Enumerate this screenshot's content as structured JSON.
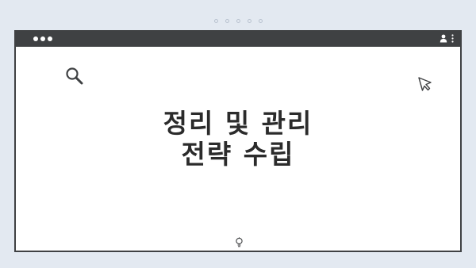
{
  "slide": {
    "title_line1": "정리 및 관리",
    "title_line2": "전략 수립"
  },
  "pager": {
    "dots": 5
  },
  "icons": {
    "search": "search-icon",
    "cursor": "cursor-arrow-icon",
    "bulb": "lightbulb-icon",
    "user": "user-icon",
    "menu": "kebab-menu-icon"
  },
  "colors": {
    "background": "#e3e9f1",
    "titlebar": "#3f4143",
    "window": "#ffffff",
    "text": "#2b2b2b"
  }
}
